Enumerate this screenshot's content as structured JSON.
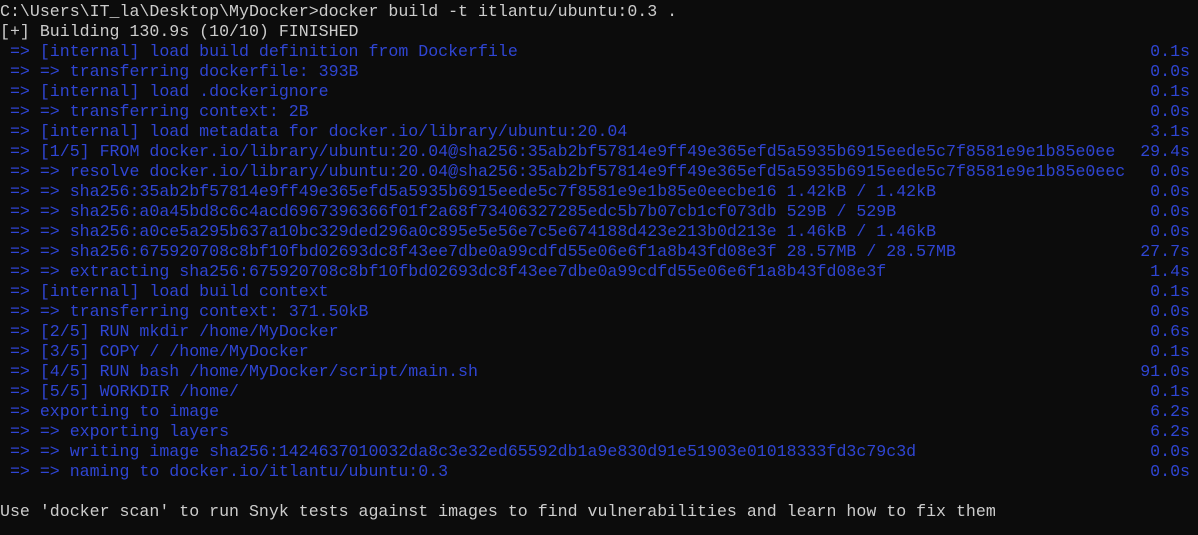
{
  "colors": {
    "background": "#0c0c0c",
    "text": "#cccccc",
    "progress": "#2f45d3"
  },
  "command_line": "C:\\Users\\IT_la\\Desktop\\MyDocker>docker build -t itlantu/ubuntu:0.3 .",
  "status": "[+] Building 130.9s (10/10) FINISHED",
  "steps": [
    {
      "text": " => [internal] load build definition from Dockerfile",
      "time": "0.1s"
    },
    {
      "text": " => => transferring dockerfile: 393B",
      "time": "0.0s"
    },
    {
      "text": " => [internal] load .dockerignore",
      "time": "0.1s"
    },
    {
      "text": " => => transferring context: 2B",
      "time": "0.0s"
    },
    {
      "text": " => [internal] load metadata for docker.io/library/ubuntu:20.04",
      "time": "3.1s"
    },
    {
      "text": " => [1/5] FROM docker.io/library/ubuntu:20.04@sha256:35ab2bf57814e9ff49e365efd5a5935b6915eede5c7f8581e9e1b85e0ee",
      "time": "29.4s"
    },
    {
      "text": " => => resolve docker.io/library/ubuntu:20.04@sha256:35ab2bf57814e9ff49e365efd5a5935b6915eede5c7f8581e9e1b85e0eec",
      "time": "0.0s"
    },
    {
      "text": " => => sha256:35ab2bf57814e9ff49e365efd5a5935b6915eede5c7f8581e9e1b85e0eecbe16 1.42kB / 1.42kB",
      "time": "0.0s"
    },
    {
      "text": " => => sha256:a0a45bd8c6c4acd6967396366f01f2a68f73406327285edc5b7b07cb1cf073db 529B / 529B",
      "time": "0.0s"
    },
    {
      "text": " => => sha256:a0ce5a295b637a10bc329ded296a0c895e5e56e7c5e674188d423e213b0d213e 1.46kB / 1.46kB",
      "time": "0.0s"
    },
    {
      "text": " => => sha256:675920708c8bf10fbd02693dc8f43ee7dbe0a99cdfd55e06e6f1a8b43fd08e3f 28.57MB / 28.57MB",
      "time": "27.7s"
    },
    {
      "text": " => => extracting sha256:675920708c8bf10fbd02693dc8f43ee7dbe0a99cdfd55e06e6f1a8b43fd08e3f",
      "time": "1.4s"
    },
    {
      "text": " => [internal] load build context",
      "time": "0.1s"
    },
    {
      "text": " => => transferring context: 371.50kB",
      "time": "0.0s"
    },
    {
      "text": " => [2/5] RUN mkdir /home/MyDocker",
      "time": "0.6s"
    },
    {
      "text": " => [3/5] COPY / /home/MyDocker",
      "time": "0.1s"
    },
    {
      "text": " => [4/5] RUN bash /home/MyDocker/script/main.sh",
      "time": "91.0s"
    },
    {
      "text": " => [5/5] WORKDIR /home/",
      "time": "0.1s"
    },
    {
      "text": " => exporting to image",
      "time": "6.2s"
    },
    {
      "text": " => => exporting layers",
      "time": "6.2s"
    },
    {
      "text": " => => writing image sha256:1424637010032da8c3e32ed65592db1a9e830d91e51903e01018333fd3c79c3d",
      "time": "0.0s"
    },
    {
      "text": " => => naming to docker.io/itlantu/ubuntu:0.3",
      "time": "0.0s"
    }
  ],
  "hint": "Use 'docker scan' to run Snyk tests against images to find vulnerabilities and learn how to fix them"
}
